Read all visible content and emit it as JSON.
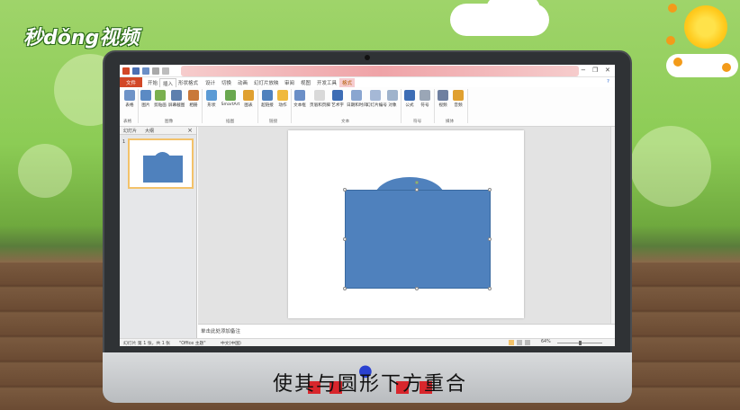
{
  "brand": {
    "logo_text": "秒dǒng视频"
  },
  "window": {
    "min": "−",
    "restore": "❐",
    "close": "✕",
    "help": "?"
  },
  "tabs": [
    "文件",
    "开始",
    "插入",
    "形状格式",
    "设计",
    "切换",
    "动画",
    "幻灯片放映",
    "审阅",
    "视图",
    "开发工具",
    "格式"
  ],
  "ribbon": {
    "buttons": [
      "表格",
      "图片",
      "剪贴画",
      "屏幕截图",
      "相册",
      "形状",
      "SmartArt",
      "图表",
      "超链接",
      "动作",
      "文本框",
      "页眉和页脚",
      "艺术字",
      "日期和时间",
      "幻灯片编号",
      "对象",
      "公式",
      "符号",
      "视频",
      "音频"
    ],
    "groups": [
      "表格",
      "图像",
      "插图",
      "链接",
      "文本",
      "符号",
      "媒体"
    ]
  },
  "left_pane": {
    "tab_slides": "幻灯片",
    "tab_outline": "大纲",
    "close": "×",
    "thumb_number": "1"
  },
  "notes": {
    "placeholder": "单击此处添加备注"
  },
  "status": {
    "slide_info": "幻灯片 第 1 张，共 1 张",
    "theme": "\"Office 主题\"",
    "language": "中文(中国)",
    "zoom": "64%"
  },
  "subtitle": "使其与圆形下方重合",
  "colors": {
    "shape_fill": "#4f81bd",
    "file_tab": "#d24726"
  }
}
